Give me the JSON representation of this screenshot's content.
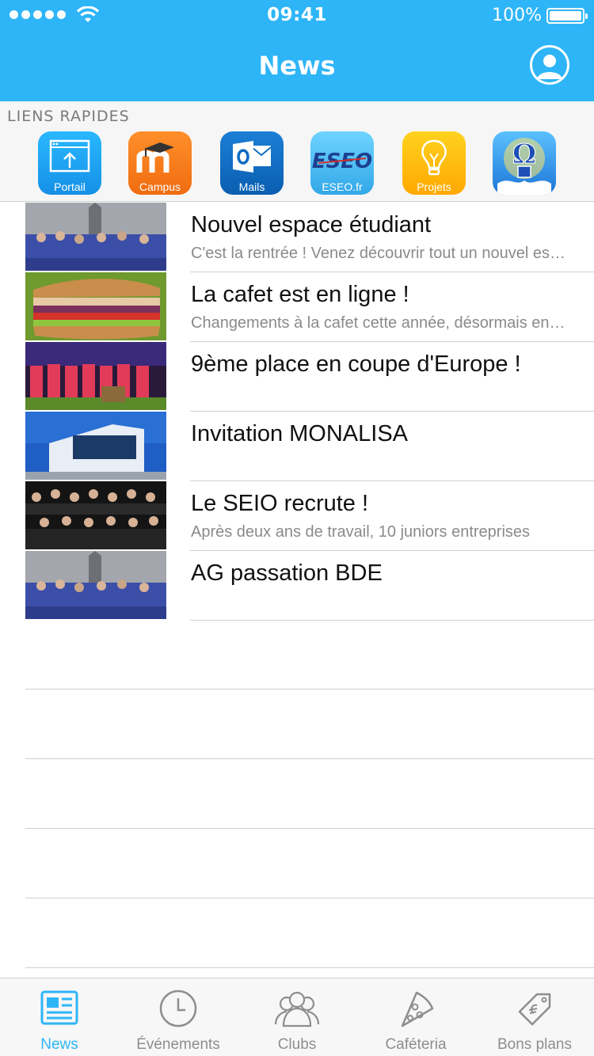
{
  "status_bar": {
    "time": "09:41",
    "battery": "100%"
  },
  "nav": {
    "title": "News"
  },
  "quick_links": {
    "title": "LIENS RAPIDES",
    "items": [
      {
        "label": "Portail",
        "icon": "portal-icon",
        "color": "#1aa0f0"
      },
      {
        "label": "Campus",
        "icon": "moodle-icon",
        "color": "#f57c17"
      },
      {
        "label": "Mails",
        "icon": "outlook-icon",
        "color": "#0d6cc2"
      },
      {
        "label": "ESEO.fr",
        "icon": "eseo-logo-icon",
        "color": "#3fb7ee"
      },
      {
        "label": "Projets",
        "icon": "lightbulb-icon",
        "color": "#ffbf12"
      },
      {
        "label": "",
        "icon": "bde-logo-icon",
        "color": "#2b8ee0"
      }
    ]
  },
  "news": [
    {
      "title": "Nouvel espace étudiant",
      "subtitle": "C'est la rentrée ! Venez découvrir tout un nouvel espace étudiant"
    },
    {
      "title": "La cafet est en ligne !",
      "subtitle": "Changements à la cafet cette année, désormais en ligne"
    },
    {
      "title": "9ème place en coupe d'Europe !",
      "subtitle": ""
    },
    {
      "title": "Invitation MONALISA",
      "subtitle": ""
    },
    {
      "title": "Le SEIO recrute !",
      "subtitle": "Après deux ans de travail, 10 juniors entreprises"
    },
    {
      "title": "AG passation BDE",
      "subtitle": ""
    }
  ],
  "tabs": [
    {
      "label": "News",
      "icon": "newspaper-icon",
      "active": true
    },
    {
      "label": "Événements",
      "icon": "clock-icon",
      "active": false
    },
    {
      "label": "Clubs",
      "icon": "people-icon",
      "active": false
    },
    {
      "label": "Caféteria",
      "icon": "pizza-icon",
      "active": false
    },
    {
      "label": "Bons plans",
      "icon": "tag-icon",
      "active": false
    }
  ],
  "colors": {
    "accent": "#2eb5f7",
    "separator": "#cfcfcf",
    "inactive_tab": "#8e8e8e"
  }
}
